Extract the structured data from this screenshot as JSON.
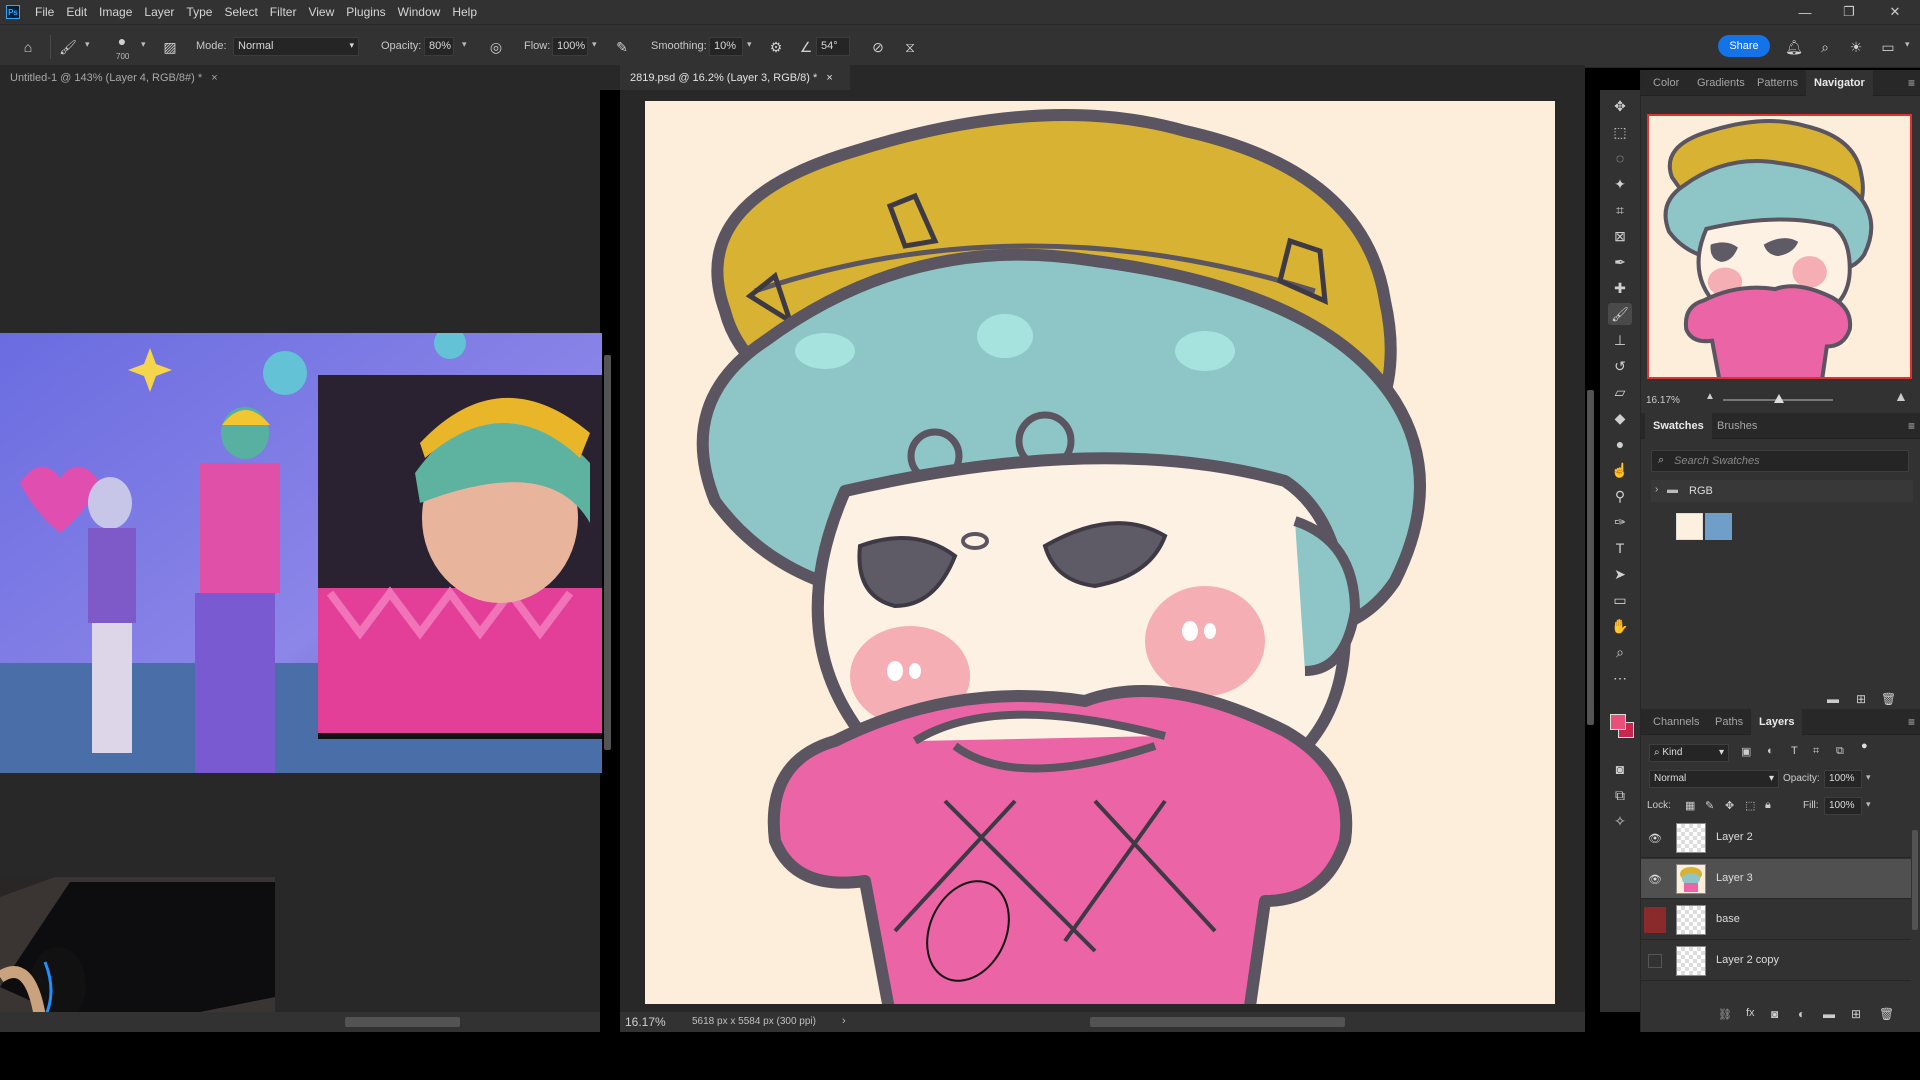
{
  "menubar": {
    "logo": "Ps",
    "items": [
      "File",
      "Edit",
      "Image",
      "Layer",
      "Type",
      "Select",
      "Filter",
      "View",
      "Plugins",
      "Window",
      "Help"
    ]
  },
  "options": {
    "brush_size": "700",
    "mode_label": "Mode:",
    "mode_value": "Normal",
    "opacity_label": "Opacity:",
    "opacity_value": "80%",
    "flow_label": "Flow:",
    "flow_value": "100%",
    "smoothing_label": "Smoothing:",
    "smoothing_value": "10%",
    "angle_value": "54°",
    "share_label": "Share"
  },
  "tabs": {
    "left": "Untitled-1 @ 143% (Layer 4, RGB/8#) *",
    "main": "2819.psd @ 16.2% (Layer 3, RGB/8) *",
    "close": "×"
  },
  "status": {
    "zoom": "16.17%",
    "doc_info": "5618 px x 5584 px (300 ppi)"
  },
  "panels": {
    "top_tabs": [
      "Color",
      "Gradients",
      "Patterns",
      "Navigator"
    ],
    "top_active": "Navigator",
    "navigator_zoom": "16.17%",
    "swatches_tabs": [
      "Swatches",
      "Brushes"
    ],
    "swatches_search_placeholder": "Search Swatches",
    "swatches_group": "RGB",
    "swatch_colors": [
      "#fdf0de",
      "#6f9ec9"
    ],
    "layers_tabs": [
      "Channels",
      "Paths",
      "Layers"
    ],
    "layers_active": "Layers",
    "filter_kind": "Kind",
    "blend_mode": "Normal",
    "opacity_label": "Opacity:",
    "opacity_value": "100%",
    "lock_label": "Lock:",
    "fill_label": "Fill:",
    "fill_value": "100%",
    "layers": [
      {
        "name": "Layer 2",
        "visible": true,
        "selected": false
      },
      {
        "name": "Layer 3",
        "visible": true,
        "selected": true
      },
      {
        "name": "base",
        "visible": false,
        "selected": false
      },
      {
        "name": "Layer 2 copy",
        "visible": false,
        "selected": false
      }
    ]
  },
  "colors": {
    "foreground": "#e8507a",
    "background": "#c8284e",
    "accent": "#1473e6"
  }
}
